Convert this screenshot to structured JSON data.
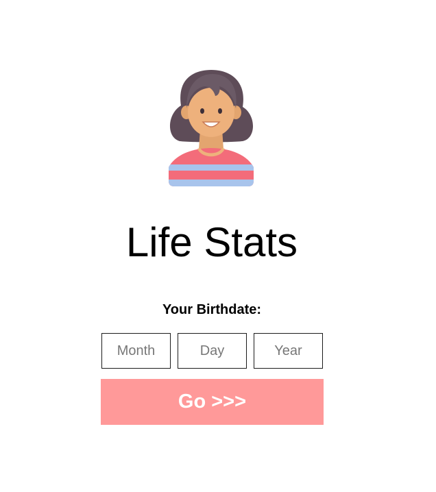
{
  "app": {
    "title": "Life Stats"
  },
  "avatar": {
    "icon": "woman-avatar-icon",
    "colors": {
      "hair": "#6b5a66",
      "skin": "#eeb17c",
      "shirt_pink": "#f36c7a",
      "shirt_blue": "#a8c4ec"
    }
  },
  "form": {
    "label": "Your Birthdate:",
    "month": {
      "value": "",
      "placeholder": "Month"
    },
    "day": {
      "value": "",
      "placeholder": "Day"
    },
    "year": {
      "value": "",
      "placeholder": "Year"
    },
    "submit_label": "Go >>>"
  },
  "colors": {
    "button_bg": "#ff9999",
    "button_text": "#ffffff",
    "input_border": "#1a1a1a",
    "placeholder": "#777777"
  }
}
